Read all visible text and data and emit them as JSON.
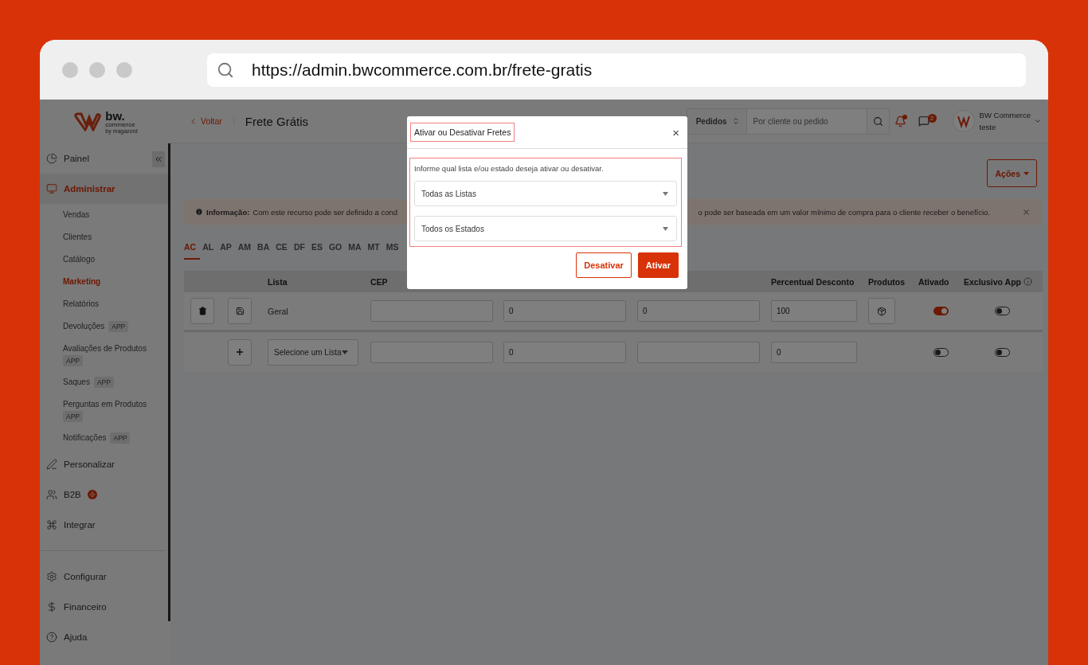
{
  "browser": {
    "url": "https://admin.bwcommerce.com.br/frete-gratis"
  },
  "logo": {
    "wordmark": "bw.",
    "tagline": "commerce",
    "byline": "by magazord"
  },
  "sidebar": {
    "items": [
      {
        "label": "Painel",
        "selected": false
      },
      {
        "label": "Administrar",
        "selected": true,
        "children": [
          {
            "label": "Vendas",
            "selected": false
          },
          {
            "label": "Clientes",
            "selected": false
          },
          {
            "label": "Catálogo",
            "selected": false
          },
          {
            "label": "Marketing",
            "selected": true
          },
          {
            "label": "Relatórios",
            "selected": false
          },
          {
            "label": "Devoluções",
            "selected": false,
            "badge": "APP"
          },
          {
            "label": "Avaliações de Produtos",
            "selected": false,
            "badge": "APP"
          },
          {
            "label": "Saques",
            "selected": false,
            "badge": "APP"
          },
          {
            "label": "Perguntas em Produtos",
            "selected": false,
            "badge": "APP"
          },
          {
            "label": "Notificações",
            "selected": false,
            "badge": "APP"
          }
        ]
      },
      {
        "label": "Personalizar",
        "selected": false
      },
      {
        "label": "B2B",
        "selected": false,
        "flag": true
      },
      {
        "label": "Integrar",
        "selected": false
      }
    ],
    "bottom_items": [
      {
        "label": "Configurar",
        "selected": false
      },
      {
        "label": "Financeiro",
        "selected": false
      },
      {
        "label": "Ajuda",
        "selected": false
      }
    ]
  },
  "header": {
    "back_link": "Voltar",
    "title": "Frete Grátis",
    "search": {
      "scope": "Pedidos",
      "placeholder": "Por cliente ou pedido"
    },
    "notifications": {
      "unread": true
    },
    "messages": {
      "count": "2"
    },
    "user": {
      "name": "BW Commerce",
      "store": "teste"
    }
  },
  "actions_button": "Ações",
  "info": {
    "label": "Informação:",
    "text_start": "Com este recurso pode ser definido a cond",
    "text_end": "o pode ser baseada em um valor mínimo de compra para o cliente receber o benefício."
  },
  "state_tabs": [
    {
      "label": "AC",
      "selected": true
    },
    {
      "label": "AL",
      "selected": false
    },
    {
      "label": "AP",
      "selected": false
    },
    {
      "label": "AM",
      "selected": false
    },
    {
      "label": "BA",
      "selected": false
    },
    {
      "label": "CE",
      "selected": false
    },
    {
      "label": "DF",
      "selected": false
    },
    {
      "label": "ES",
      "selected": false
    },
    {
      "label": "GO",
      "selected": false
    },
    {
      "label": "MA",
      "selected": false
    },
    {
      "label": "MT",
      "selected": false
    },
    {
      "label": "MS",
      "selected": false
    }
  ],
  "table": {
    "columns": {
      "lista": "Lista",
      "cep": "CEP",
      "percentual_desconto": "Percentual Desconto",
      "produtos": "Produtos",
      "ativado": "Ativado",
      "exclusivo_app": "Exclusivo App"
    },
    "rows": [
      {
        "kind": "saved",
        "lista": "Geral",
        "column_4": "0",
        "column_5": "0",
        "percentual_desconto": "100",
        "ativado": true,
        "exclusivo_app": false
      },
      {
        "kind": "new",
        "lista_placeholder": "Selecione um Lista",
        "column_4": "0",
        "percentual_desconto": "0",
        "ativado": false,
        "exclusivo_app": false
      }
    ]
  },
  "modal": {
    "title": "Ativar ou Desativar Fretes",
    "close": "×",
    "hint": "Informe qual lista e/ou estado deseja ativar ou desativar.",
    "selects": [
      "Todas as Listas",
      "Todos os Estados"
    ],
    "buttons": [
      {
        "label": "Desativar",
        "kind": "outline"
      },
      {
        "label": "Ativar",
        "kind": "primary"
      }
    ]
  }
}
